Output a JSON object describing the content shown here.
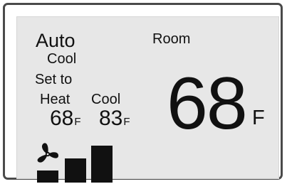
{
  "display": {
    "mode": "Auto",
    "submode": "Cool",
    "room_label": "Room",
    "set_to_label": "Set to",
    "heat_label": "Heat",
    "cool_label": "Cool",
    "heat_setpoint": "68",
    "cool_setpoint": "83",
    "setpoint_unit": "F",
    "room_temperature": "68",
    "room_unit": "F"
  },
  "fan": {
    "icon": "fan-icon",
    "speed_level": 3,
    "speed_levels_total": 3
  },
  "colors": {
    "screen_background": "#e7e7e7",
    "frame_border": "#4a4a4a",
    "text": "#111111"
  }
}
